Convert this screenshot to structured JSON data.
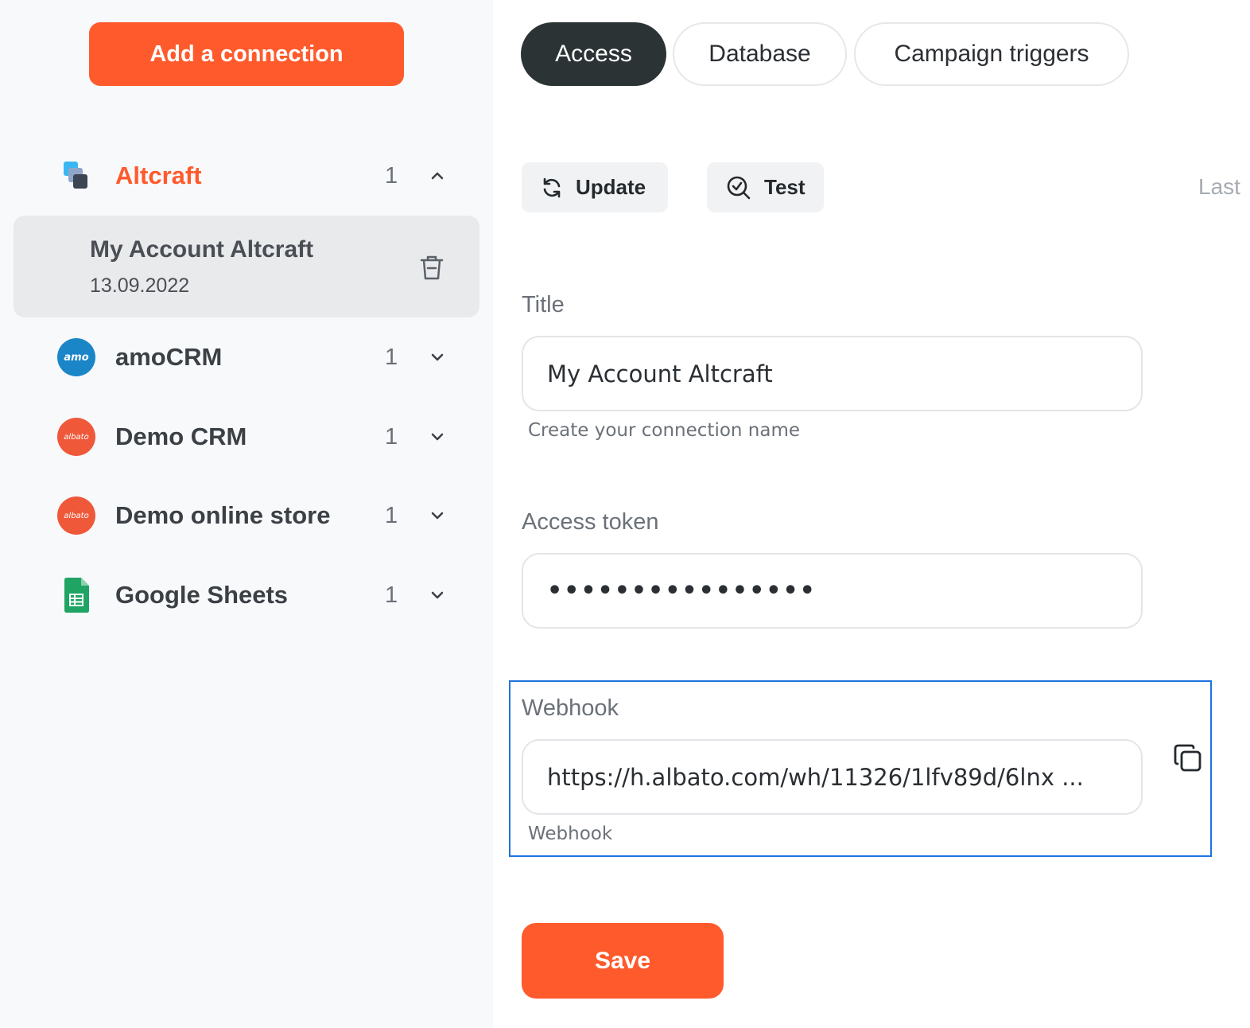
{
  "sidebar": {
    "add_button_label": "Add a connection",
    "groups": [
      {
        "name": "Altcraft",
        "count": "1",
        "icon": "altcraft-logo-icon",
        "expanded": true
      },
      {
        "name": "amoCRM",
        "count": "1",
        "icon": "amocrm-logo-icon",
        "logo_text": "amo",
        "color": "#1a86c8"
      },
      {
        "name": "Demo CRM",
        "count": "1",
        "icon": "albato-logo-icon",
        "logo_text": "albato",
        "color": "#f0583a"
      },
      {
        "name": "Demo online store",
        "count": "1",
        "icon": "albato-logo-icon",
        "logo_text": "albato",
        "color": "#f0583a"
      },
      {
        "name": "Google Sheets",
        "count": "1",
        "icon": "google-sheets-icon",
        "color": "#0f9d58"
      }
    ],
    "selected_account": {
      "name": "My Account Altcraft",
      "date": "13.09.2022"
    }
  },
  "tabs": [
    {
      "label": "Access",
      "active": true
    },
    {
      "label": "Database",
      "active": false
    },
    {
      "label": "Campaign triggers",
      "active": false
    }
  ],
  "toolbar": {
    "update_label": "Update",
    "test_label": "Test",
    "last_label": "Last"
  },
  "form": {
    "title_label": "Title",
    "title_value": "My Account Altcraft",
    "title_hint": "Create your connection name",
    "token_label": "Access token",
    "token_value": "••••••••••••••••",
    "webhook_label": "Webhook",
    "webhook_value": "https://h.albato.com/wh/11326/1lfv89d/6lnx ...",
    "webhook_hint": "Webhook",
    "save_label": "Save"
  },
  "colors": {
    "accent": "#ff5a2c",
    "dark_tab": "#2b3335",
    "focus": "#1f73e0"
  }
}
